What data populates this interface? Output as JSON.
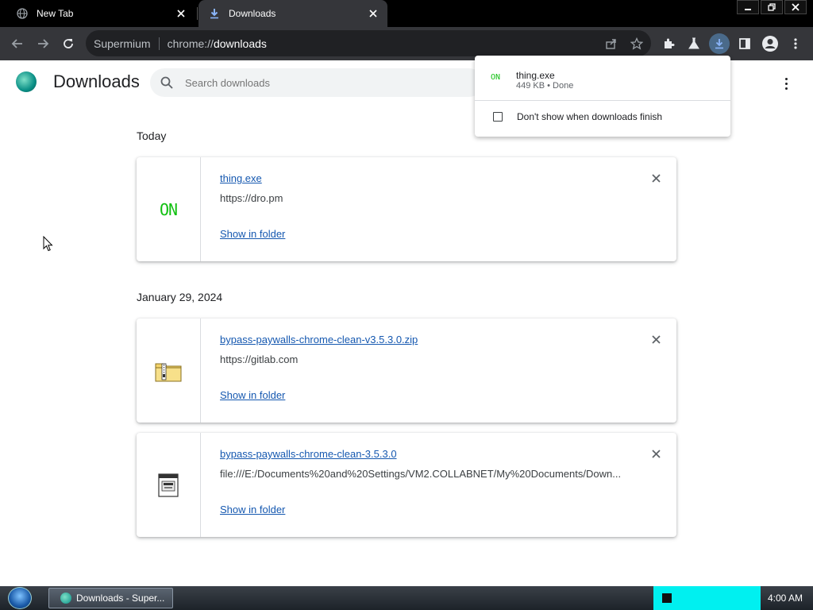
{
  "tabs": [
    {
      "title": "New Tab",
      "active": false
    },
    {
      "title": "Downloads",
      "active": true
    }
  ],
  "omnibox": {
    "brand": "Supermium",
    "url_prefix": "chrome://",
    "url_host": "downloads"
  },
  "page": {
    "title": "Downloads",
    "search_placeholder": "Search downloads"
  },
  "groups": [
    {
      "date": "Today",
      "items": [
        {
          "name": "thing.exe",
          "url": "https://dro.pm",
          "action": "Show in folder",
          "icon": "on-exe-icon"
        }
      ]
    },
    {
      "date": "January 29, 2024",
      "items": [
        {
          "name": "bypass-paywalls-chrome-clean-v3.5.3.0.zip",
          "url": "https://gitlab.com",
          "action": "Show in folder",
          "icon": "zip-folder-icon"
        },
        {
          "name": "bypass-paywalls-chrome-clean-3.5.3.0",
          "url": "file:///E:/Documents%20and%20Settings/VM2.COLLABNET/My%20Documents/Down...",
          "action": "Show in folder",
          "icon": "exe-file-icon"
        }
      ]
    }
  ],
  "bubble": {
    "file_icon_text": "ON",
    "file_name": "thing.exe",
    "file_status": "449 KB • Done",
    "checkbox_label": "Don't show when downloads finish"
  },
  "card_icon_text": "ON",
  "taskbar": {
    "task_label": "Downloads - Super...",
    "clock": "4:00 AM"
  },
  "colors": {
    "accent": "#1558b0",
    "on_green": "#10c010",
    "tray_cyan": "#00f0f0"
  }
}
